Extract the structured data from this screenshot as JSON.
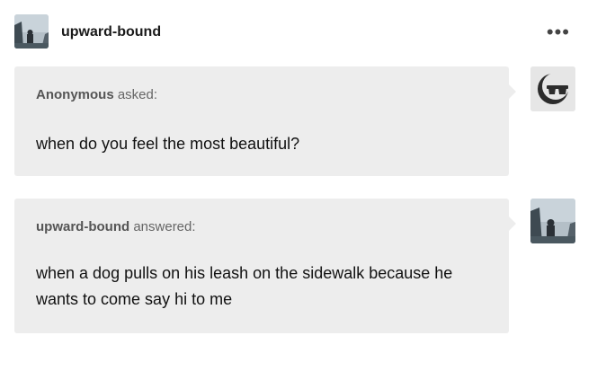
{
  "post": {
    "blog_name": "upward-bound",
    "more_icon": "ellipsis-icon",
    "question": {
      "asker_name": "Anonymous",
      "asker_suffix": "asked:",
      "text": "when do you feel the most beautiful?"
    },
    "answer": {
      "answerer_name": "upward-bound",
      "answerer_suffix": "answered:",
      "text": "when a dog pulls on his leash on the sidewalk because he wants to come say hi to me"
    }
  },
  "colors": {
    "bubble_bg": "#ededed",
    "meta_text": "#666666",
    "body_text": "#111111"
  }
}
